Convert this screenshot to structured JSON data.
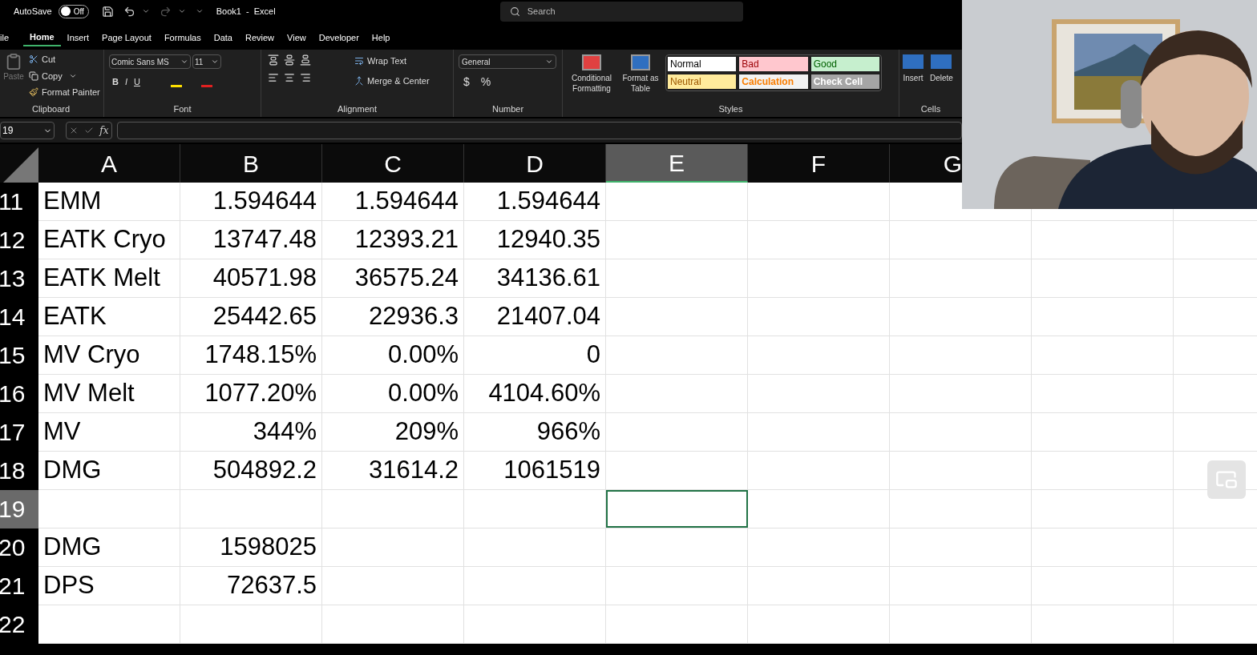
{
  "title_bar": {
    "autosave_label": "AutoSave",
    "autosave_on": false,
    "toggle_text": "Off",
    "document_title": "Book1  -  Excel",
    "search": {
      "placeholder": "Search"
    }
  },
  "menu_tabs": [
    {
      "label": "ile",
      "selected": false
    },
    {
      "label": "Home",
      "selected": true
    },
    {
      "label": "Insert",
      "selected": false
    },
    {
      "label": "Page Layout",
      "selected": false
    },
    {
      "label": "Formulas",
      "selected": false
    },
    {
      "label": "Data",
      "selected": false
    },
    {
      "label": "Review",
      "selected": false
    },
    {
      "label": "View",
      "selected": false
    },
    {
      "label": "Developer",
      "selected": false
    },
    {
      "label": "Help",
      "selected": false
    }
  ],
  "ribbon": {
    "clipboard": {
      "paste": {
        "label": "Paste",
        "disabled": true
      },
      "cut": "Cut",
      "copy": "Copy",
      "format_painter": "Format Painter",
      "label": "Clipboard"
    },
    "font": {
      "font_name": "Comic Sans MS",
      "font_size": "11",
      "bold": "B",
      "italic": "I",
      "underline": "U",
      "label": "Font"
    },
    "alignment": {
      "wrap_text": "Wrap Text",
      "merge_center": "Merge & Center",
      "label": "Alignment"
    },
    "number": {
      "format": "General",
      "currency": "$",
      "percent": "%",
      "label": "Number"
    },
    "styles": {
      "conditional": [
        "Conditional",
        "Formatting"
      ],
      "format_table": [
        "Format as",
        "Table"
      ],
      "label": "Styles",
      "cell_styles": [
        {
          "label": "Normal",
          "kind": "normal",
          "color": "#ffffff"
        },
        {
          "label": "Bad",
          "kind": "bad",
          "color": "#ffc7ce"
        },
        {
          "label": "Good",
          "kind": "good",
          "color": "#c6efce"
        },
        {
          "label": "Neutral",
          "kind": "neutral",
          "color": "#ffeb9c"
        },
        {
          "label": "Calculation",
          "kind": "calculation",
          "color": "#f2f2f2"
        },
        {
          "label": "Check Cell",
          "kind": "check",
          "color": "#a5a5a5"
        }
      ]
    },
    "cells": {
      "insert": "Insert",
      "delete": "Delete",
      "label": "Cells"
    }
  },
  "formula_bar": {
    "name_box": "19",
    "fx": "fx"
  },
  "sheet": {
    "columns": [
      {
        "label": "A",
        "selected": false
      },
      {
        "label": "B",
        "selected": false
      },
      {
        "label": "C",
        "selected": false
      },
      {
        "label": "D",
        "selected": false
      },
      {
        "label": "E",
        "selected": true
      },
      {
        "label": "F",
        "selected": false
      },
      {
        "label": "G",
        "selected": false
      }
    ],
    "rows": [
      {
        "number": "11",
        "selected": false,
        "cells": [
          "EMM",
          "1.594644",
          "1.594644",
          "1.594644"
        ]
      },
      {
        "number": "12",
        "selected": false,
        "cells": [
          "EATK Cryo",
          "13747.48",
          "12393.21",
          "12940.35"
        ]
      },
      {
        "number": "13",
        "selected": false,
        "cells": [
          "EATK Melt",
          "40571.98",
          "36575.24",
          "34136.61"
        ]
      },
      {
        "number": "14",
        "selected": false,
        "cells": [
          "EATK",
          "25442.65",
          "22936.3",
          "21407.04"
        ]
      },
      {
        "number": "15",
        "selected": false,
        "cells": [
          "MV Cryo",
          "1748.15%",
          "0.00%",
          "0"
        ]
      },
      {
        "number": "16",
        "selected": false,
        "cells": [
          "MV Melt",
          "1077.20%",
          "0.00%",
          "4104.60%"
        ]
      },
      {
        "number": "17",
        "selected": false,
        "cells": [
          "MV",
          "344%",
          "209%",
          "966%"
        ]
      },
      {
        "number": "18",
        "selected": false,
        "cells": [
          "DMG",
          "504892.2",
          "31614.2",
          "1061519"
        ]
      },
      {
        "number": "19",
        "selected": true,
        "cells": []
      },
      {
        "number": "20",
        "selected": false,
        "cells": [
          "DMG",
          "1598025"
        ]
      },
      {
        "number": "21",
        "selected": false,
        "cells": [
          "DPS",
          "72637.5"
        ]
      },
      {
        "number": "22",
        "selected": false,
        "cells": []
      }
    ]
  }
}
